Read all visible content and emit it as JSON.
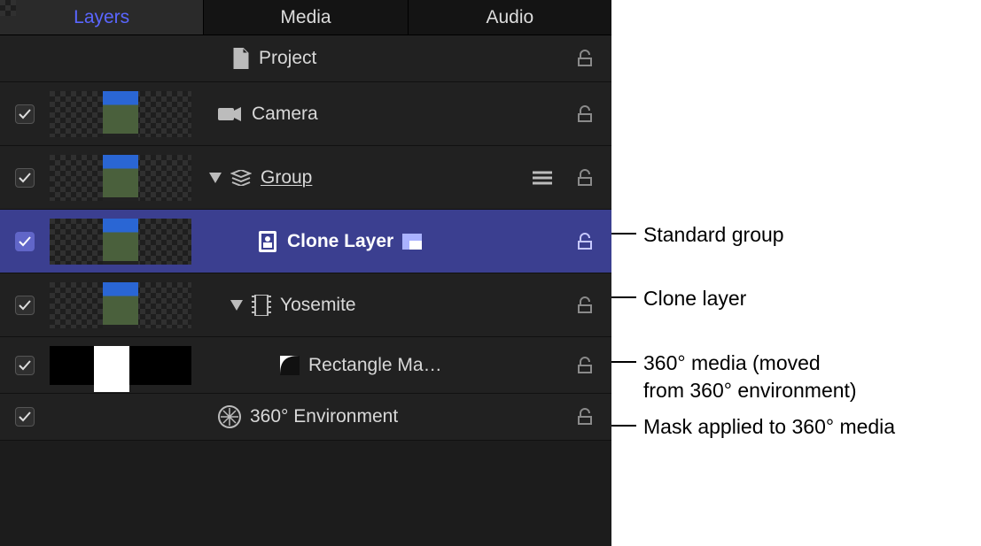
{
  "tabs": {
    "layers": "Layers",
    "media": "Media",
    "audio": "Audio"
  },
  "rows": {
    "project": {
      "label": "Project"
    },
    "camera": {
      "label": "Camera"
    },
    "group": {
      "label": "Group"
    },
    "clone": {
      "label": "Clone Layer"
    },
    "yosemite": {
      "label": "Yosemite"
    },
    "mask": {
      "label": "Rectangle Ma…"
    },
    "env": {
      "label": "360° Environment"
    }
  },
  "annotations": {
    "group": "Standard group",
    "clone": "Clone layer",
    "media": "360° media (moved\nfrom 360° environment)",
    "mask": "Mask applied to 360° media"
  }
}
